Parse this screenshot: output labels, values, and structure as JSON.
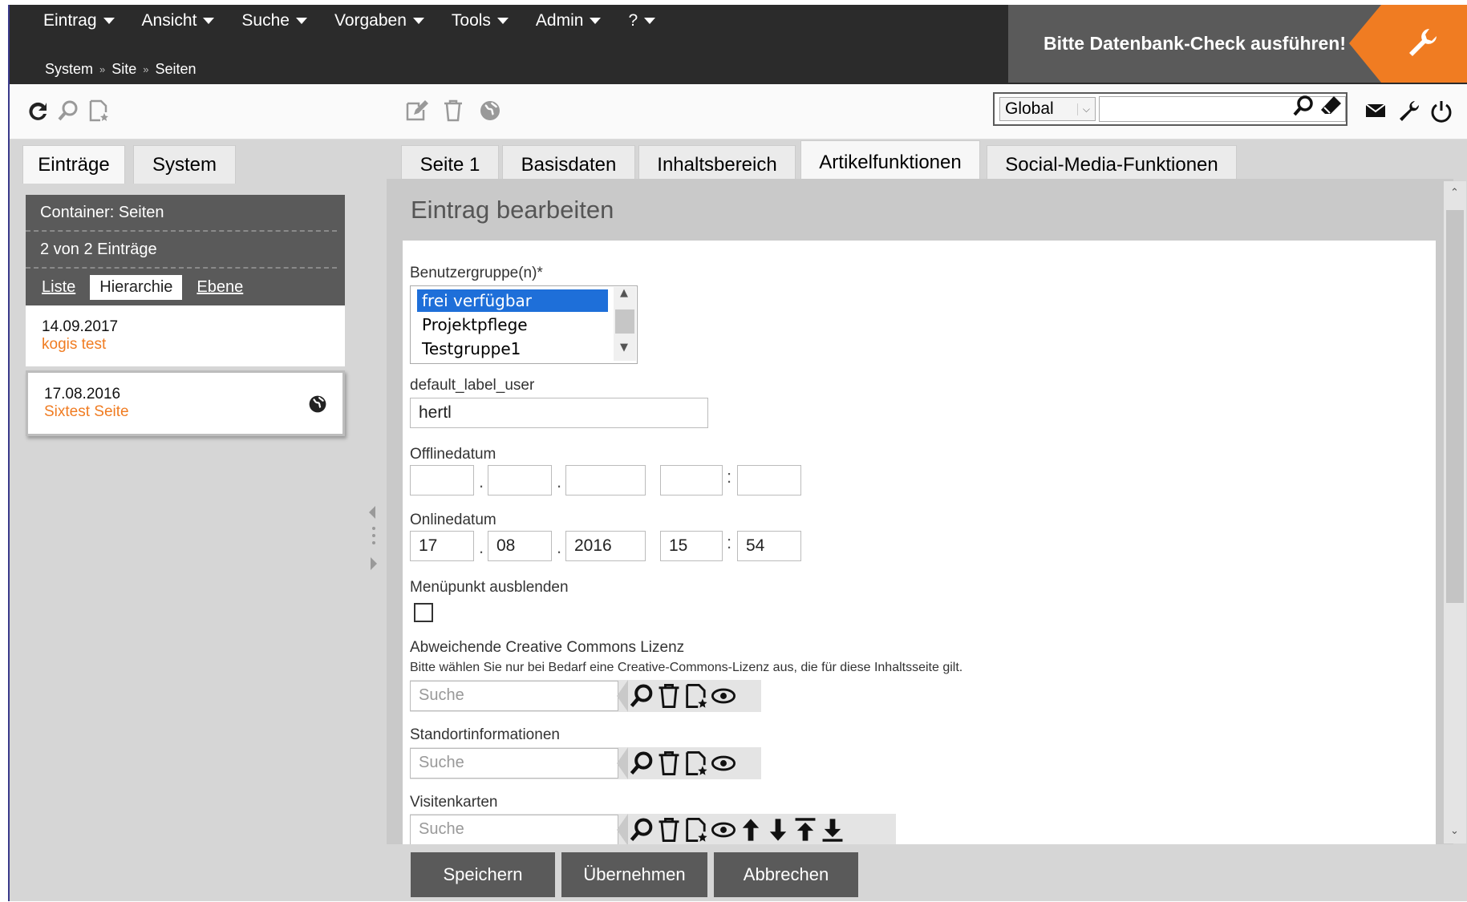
{
  "menu": [
    {
      "label": "Eintrag"
    },
    {
      "label": "Ansicht"
    },
    {
      "label": "Suche"
    },
    {
      "label": "Vorgaben"
    },
    {
      "label": "Tools"
    },
    {
      "label": "Admin"
    },
    {
      "label": "?"
    }
  ],
  "breadcrumb": [
    "System",
    "Site",
    "Seiten"
  ],
  "db_warning": "Bitte Datenbank-Check ausführen!",
  "search": {
    "scope": "Global",
    "value": ""
  },
  "left_tabs": [
    "Einträge",
    "System"
  ],
  "left_panel": {
    "container": "Container: Seiten",
    "count": "2 von 2 Einträge",
    "views": [
      "Liste",
      "Hierarchie",
      "Ebene"
    ],
    "active_view": "Hierarchie",
    "entries": [
      {
        "date": "14.09.2017",
        "title": "kogis test"
      },
      {
        "date": "17.08.2016",
        "title": "Sixtest Seite"
      }
    ]
  },
  "right_tabs": [
    "Seite 1",
    "Basisdaten",
    "Inhaltsbereich",
    "Artikelfunktionen",
    "Social-Media-Funktionen"
  ],
  "active_right_tab": "Artikelfunktionen",
  "page_title": "Eintrag bearbeiten",
  "form": {
    "usergroups_label": "Benutzergruppe(n)*",
    "usergroups": [
      "frei verfügbar",
      "Projektpflege",
      "Testgruppe1"
    ],
    "selected_usergroup": "frei verfügbar",
    "user_label": "default_label_user",
    "user_value": "hertl",
    "offline_label": "Offlinedatum",
    "offline": {
      "day": "",
      "month": "",
      "year": "",
      "hour": "",
      "minute": ""
    },
    "online_label": "Onlinedatum",
    "online": {
      "day": "17",
      "month": "08",
      "year": "2016",
      "hour": "15",
      "minute": "54"
    },
    "menu_hide_label": "Menüpunkt ausblenden",
    "menu_hide_checked": false,
    "cc_label": "Abweichende Creative Commons Lizenz",
    "cc_hint": "Bitte wählen Sie nur bei Bedarf eine Creative-Commons-Lizenz aus, die für diese Inhaltsseite gilt.",
    "location_label": "Standortinformationen",
    "cards_label": "Visitenkarten",
    "search_placeholder": "Suche"
  },
  "buttons": {
    "save": "Speichern",
    "apply": "Übernehmen",
    "cancel": "Abbrechen"
  },
  "colors": {
    "accent": "#f07c22",
    "dark": "#2b2b2b",
    "panel": "#5a5a5a",
    "selection": "#1e6fd9"
  }
}
